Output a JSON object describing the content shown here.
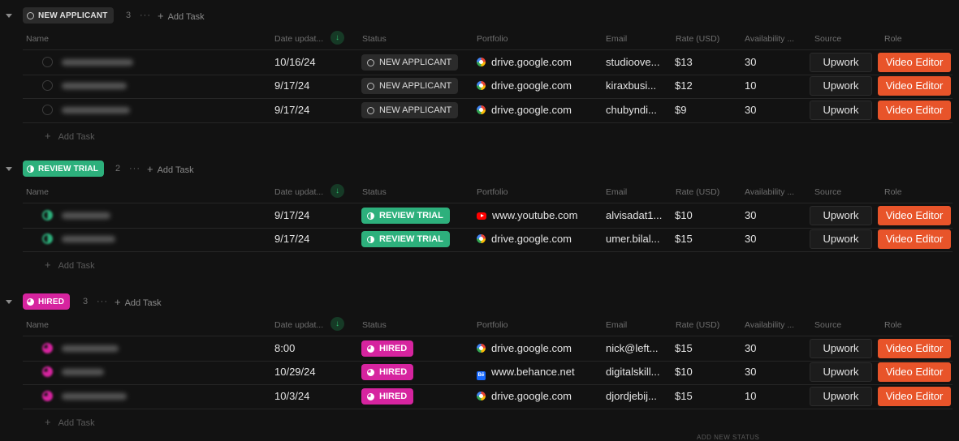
{
  "columns": {
    "name": "Name",
    "date_updated": "Date updat...",
    "date_updated_first": "Date updat...",
    "status": "Status",
    "portfolio": "Portfolio",
    "email": "Email",
    "rate": "Rate (USD)",
    "availability": "Availability ...",
    "source": "Source",
    "role": "Role",
    "sort_icon": "↓"
  },
  "add_task_label": "Add Task",
  "plus_icon": "+",
  "more_icon": "···",
  "colors": {
    "new_applicant": "#2b2b2b",
    "review_trial": "#2db07c",
    "hired": "#d6249f",
    "role_button": "#e8542a",
    "sort_accent": "#2fbf6e"
  },
  "groups": [
    {
      "status_label": "NEW APPLICANT",
      "count": "3",
      "rows": [
        {
          "date": "10/16/24",
          "status": "NEW APPLICANT",
          "portfolio": "drive.google.com",
          "favicon": "google-drive-icon",
          "email": "studioove...",
          "rate": "$13",
          "availability": "30",
          "source": "Upwork",
          "role": "Video Editor"
        },
        {
          "date": "9/17/24",
          "status": "NEW APPLICANT",
          "portfolio": "drive.google.com",
          "favicon": "google-drive-icon",
          "email": "kiraxbusi...",
          "rate": "$12",
          "availability": "10",
          "source": "Upwork",
          "role": "Video Editor"
        },
        {
          "date": "9/17/24",
          "status": "NEW APPLICANT",
          "portfolio": "drive.google.com",
          "favicon": "google-drive-icon",
          "email": "chubyndi...",
          "rate": "$9",
          "availability": "30",
          "source": "Upwork",
          "role": "Video Editor"
        }
      ]
    },
    {
      "status_label": "REVIEW TRIAL",
      "count": "2",
      "rows": [
        {
          "date": "9/17/24",
          "status": "REVIEW TRIAL",
          "portfolio": "www.youtube.com",
          "favicon": "youtube-icon",
          "email": "alvisadat1...",
          "rate": "$10",
          "availability": "30",
          "source": "Upwork",
          "role": "Video Editor"
        },
        {
          "date": "9/17/24",
          "status": "REVIEW TRIAL",
          "portfolio": "drive.google.com",
          "favicon": "google-drive-icon",
          "email": "umer.bilal...",
          "rate": "$15",
          "availability": "30",
          "source": "Upwork",
          "role": "Video Editor"
        }
      ]
    },
    {
      "status_label": "HIRED",
      "count": "3",
      "rows": [
        {
          "date": "8:00",
          "status": "HIRED",
          "portfolio": "drive.google.com",
          "favicon": "google-drive-icon",
          "email": "nick@left...",
          "rate": "$15",
          "availability": "30",
          "source": "Upwork",
          "role": "Video Editor"
        },
        {
          "date": "10/29/24",
          "status": "HIRED",
          "portfolio": "www.behance.net",
          "favicon": "behance-icon",
          "email": "digitalskill...",
          "rate": "$10",
          "availability": "30",
          "source": "Upwork",
          "role": "Video Editor"
        },
        {
          "date": "10/3/24",
          "status": "HIRED",
          "portfolio": "drive.google.com",
          "favicon": "google-drive-icon",
          "email": "djordjebij...",
          "rate": "$15",
          "availability": "10",
          "source": "Upwork",
          "role": "Video Editor"
        }
      ]
    }
  ],
  "footer_text": "ADD NEW STATUS"
}
